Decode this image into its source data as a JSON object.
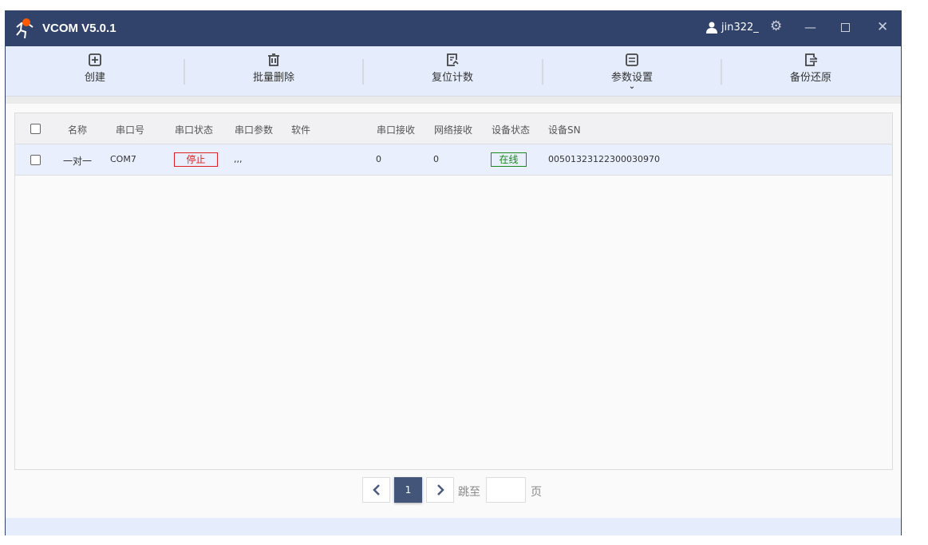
{
  "app": {
    "title": "VCOM V5.0.1",
    "username": "jin322_"
  },
  "toolbar": {
    "items": [
      {
        "label": "创建",
        "icon": "plus-square-icon"
      },
      {
        "label": "批量删除",
        "icon": "trash-icon"
      },
      {
        "label": "复位计数",
        "icon": "reset-icon"
      },
      {
        "label": "参数设置",
        "icon": "sliders-icon"
      },
      {
        "label": "备份还原",
        "icon": "backup-icon"
      }
    ]
  },
  "table": {
    "headers": [
      "名称",
      "串口号",
      "串口状态",
      "串口参数",
      "软件",
      "串口接收",
      "网络接收",
      "设备状态",
      "设备SN"
    ],
    "rows": [
      {
        "name": "一对一",
        "port": "COM7",
        "port_status": "停止",
        "params": ",,,",
        "software": "",
        "serial_rx": "0",
        "net_rx": "0",
        "device_status": "在线",
        "sn": "00501323122300030970"
      }
    ]
  },
  "pagination": {
    "current": "1",
    "goto_label": "跳至",
    "goto_value": "",
    "page_suffix": "页"
  },
  "colors": {
    "title_bg": "#32436b",
    "stop": "#e02020",
    "online": "#1a8a1a"
  }
}
